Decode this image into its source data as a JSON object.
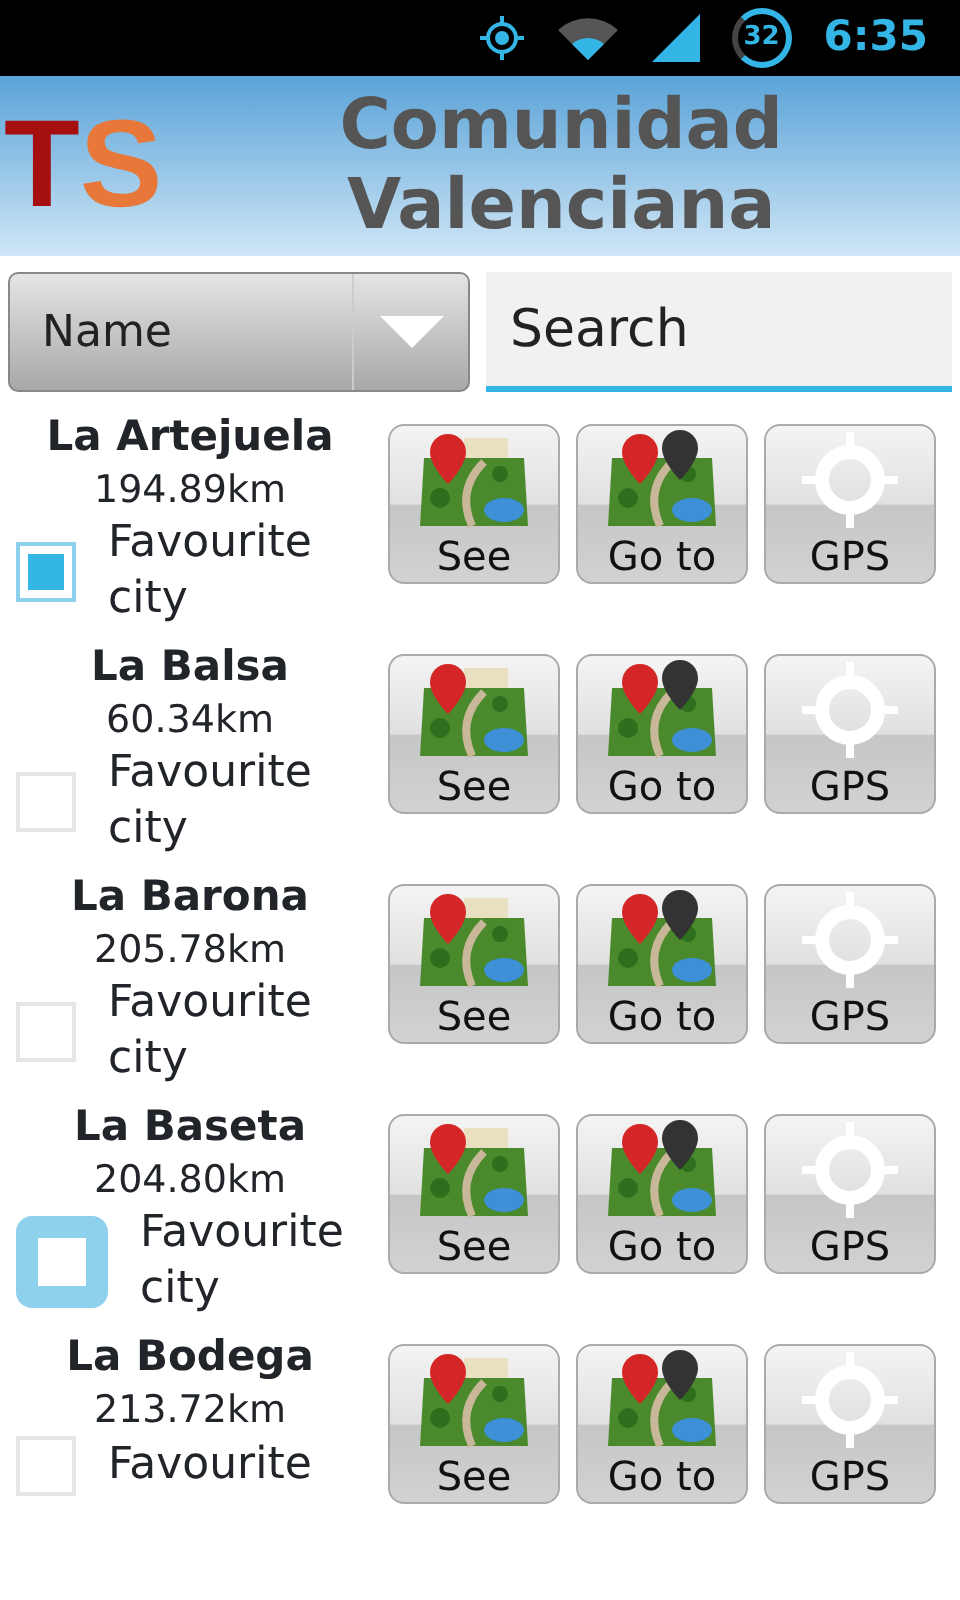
{
  "status_bar": {
    "battery": "32",
    "time": "6:35"
  },
  "header": {
    "logo": "TS",
    "title": "Comunidad Valenciana"
  },
  "controls": {
    "sort": {
      "value": "Name"
    },
    "search": {
      "placeholder": "Search"
    }
  },
  "places": [
    {
      "name": "La Artejuela",
      "distance": "194.89km",
      "favourite_label": "Favourite city",
      "checked": true,
      "focused": false,
      "buttons": [
        {
          "kind": "see",
          "label": "See"
        },
        {
          "kind": "goto",
          "label": "Go to"
        },
        {
          "kind": "gps",
          "label": "GPS"
        }
      ]
    },
    {
      "name": "La Balsa",
      "distance": "60.34km",
      "favourite_label": "Favourite city",
      "checked": false,
      "focused": false,
      "buttons": [
        {
          "kind": "see",
          "label": "See"
        },
        {
          "kind": "goto",
          "label": "Go to"
        },
        {
          "kind": "gps",
          "label": "GPS"
        }
      ]
    },
    {
      "name": "La Barona",
      "distance": "205.78km",
      "favourite_label": "Favourite city",
      "checked": false,
      "focused": false,
      "buttons": [
        {
          "kind": "see",
          "label": "See"
        },
        {
          "kind": "goto",
          "label": "Go to"
        },
        {
          "kind": "gps",
          "label": "GPS"
        }
      ]
    },
    {
      "name": "La Baseta",
      "distance": "204.80km",
      "favourite_label": "Favourite city",
      "checked": false,
      "focused": true,
      "buttons": [
        {
          "kind": "see",
          "label": "See"
        },
        {
          "kind": "goto",
          "label": "Go to"
        },
        {
          "kind": "gps",
          "label": "GPS"
        }
      ]
    },
    {
      "name": "La Bodega",
      "distance": "213.72km",
      "favourite_label": "Favourite",
      "checked": false,
      "focused": false,
      "buttons": [
        {
          "kind": "see",
          "label": "See"
        },
        {
          "kind": "goto",
          "label": "Go to"
        },
        {
          "kind": "gps",
          "label": "GPS"
        }
      ]
    }
  ]
}
